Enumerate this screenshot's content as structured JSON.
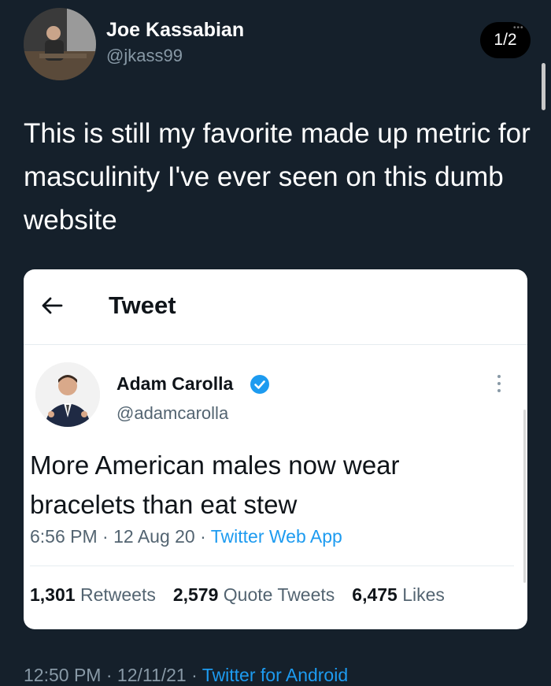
{
  "author": {
    "name": "Joe Kassabian",
    "handle": "@jkass99",
    "avatar_icon": "profile-photo-icon"
  },
  "page_indicator": "1/2",
  "tweet_text": "This is still my favorite made up metric for masculinity I've ever seen on this dumb website",
  "embedded": {
    "header_title": "Tweet",
    "back_icon": "back-arrow-icon",
    "author_name": "Adam Carolla",
    "author_handle": "@adamcarolla",
    "verified_icon": "verified-badge-icon",
    "more_icon": "more-vertical-icon",
    "text": "More American males now wear bracelets  than eat stew",
    "time": "6:56 PM",
    "date": "12 Aug 20",
    "source": "Twitter Web App",
    "stats": {
      "retweets_count": "1,301",
      "retweets_label": "Retweets",
      "quotes_count": "2,579",
      "quotes_label": "Quote Tweets",
      "likes_count": "6,475",
      "likes_label": "Likes"
    }
  },
  "footer": {
    "time": "12:50 PM",
    "date": "12/11/21",
    "source": "Twitter for Android"
  },
  "colors": {
    "background": "#15202b",
    "link": "#1d9bf0",
    "verified": "#1d9bf0"
  }
}
